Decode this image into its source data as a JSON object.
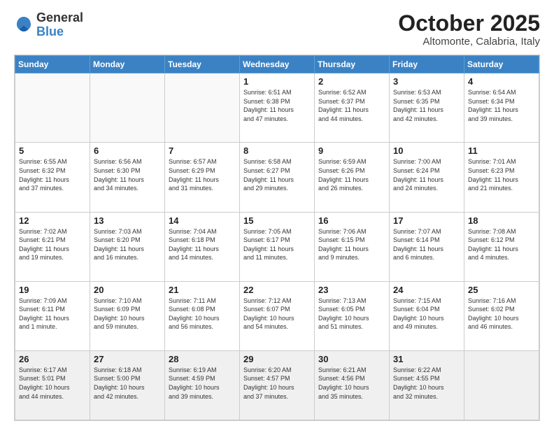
{
  "header": {
    "logo_general": "General",
    "logo_blue": "Blue",
    "month_title": "October 2025",
    "subtitle": "Altomonte, Calabria, Italy"
  },
  "days_of_week": [
    "Sunday",
    "Monday",
    "Tuesday",
    "Wednesday",
    "Thursday",
    "Friday",
    "Saturday"
  ],
  "weeks": [
    [
      {
        "day": "",
        "info": ""
      },
      {
        "day": "",
        "info": ""
      },
      {
        "day": "",
        "info": ""
      },
      {
        "day": "1",
        "info": "Sunrise: 6:51 AM\nSunset: 6:38 PM\nDaylight: 11 hours\nand 47 minutes."
      },
      {
        "day": "2",
        "info": "Sunrise: 6:52 AM\nSunset: 6:37 PM\nDaylight: 11 hours\nand 44 minutes."
      },
      {
        "day": "3",
        "info": "Sunrise: 6:53 AM\nSunset: 6:35 PM\nDaylight: 11 hours\nand 42 minutes."
      },
      {
        "day": "4",
        "info": "Sunrise: 6:54 AM\nSunset: 6:34 PM\nDaylight: 11 hours\nand 39 minutes."
      }
    ],
    [
      {
        "day": "5",
        "info": "Sunrise: 6:55 AM\nSunset: 6:32 PM\nDaylight: 11 hours\nand 37 minutes."
      },
      {
        "day": "6",
        "info": "Sunrise: 6:56 AM\nSunset: 6:30 PM\nDaylight: 11 hours\nand 34 minutes."
      },
      {
        "day": "7",
        "info": "Sunrise: 6:57 AM\nSunset: 6:29 PM\nDaylight: 11 hours\nand 31 minutes."
      },
      {
        "day": "8",
        "info": "Sunrise: 6:58 AM\nSunset: 6:27 PM\nDaylight: 11 hours\nand 29 minutes."
      },
      {
        "day": "9",
        "info": "Sunrise: 6:59 AM\nSunset: 6:26 PM\nDaylight: 11 hours\nand 26 minutes."
      },
      {
        "day": "10",
        "info": "Sunrise: 7:00 AM\nSunset: 6:24 PM\nDaylight: 11 hours\nand 24 minutes."
      },
      {
        "day": "11",
        "info": "Sunrise: 7:01 AM\nSunset: 6:23 PM\nDaylight: 11 hours\nand 21 minutes."
      }
    ],
    [
      {
        "day": "12",
        "info": "Sunrise: 7:02 AM\nSunset: 6:21 PM\nDaylight: 11 hours\nand 19 minutes."
      },
      {
        "day": "13",
        "info": "Sunrise: 7:03 AM\nSunset: 6:20 PM\nDaylight: 11 hours\nand 16 minutes."
      },
      {
        "day": "14",
        "info": "Sunrise: 7:04 AM\nSunset: 6:18 PM\nDaylight: 11 hours\nand 14 minutes."
      },
      {
        "day": "15",
        "info": "Sunrise: 7:05 AM\nSunset: 6:17 PM\nDaylight: 11 hours\nand 11 minutes."
      },
      {
        "day": "16",
        "info": "Sunrise: 7:06 AM\nSunset: 6:15 PM\nDaylight: 11 hours\nand 9 minutes."
      },
      {
        "day": "17",
        "info": "Sunrise: 7:07 AM\nSunset: 6:14 PM\nDaylight: 11 hours\nand 6 minutes."
      },
      {
        "day": "18",
        "info": "Sunrise: 7:08 AM\nSunset: 6:12 PM\nDaylight: 11 hours\nand 4 minutes."
      }
    ],
    [
      {
        "day": "19",
        "info": "Sunrise: 7:09 AM\nSunset: 6:11 PM\nDaylight: 11 hours\nand 1 minute."
      },
      {
        "day": "20",
        "info": "Sunrise: 7:10 AM\nSunset: 6:09 PM\nDaylight: 10 hours\nand 59 minutes."
      },
      {
        "day": "21",
        "info": "Sunrise: 7:11 AM\nSunset: 6:08 PM\nDaylight: 10 hours\nand 56 minutes."
      },
      {
        "day": "22",
        "info": "Sunrise: 7:12 AM\nSunset: 6:07 PM\nDaylight: 10 hours\nand 54 minutes."
      },
      {
        "day": "23",
        "info": "Sunrise: 7:13 AM\nSunset: 6:05 PM\nDaylight: 10 hours\nand 51 minutes."
      },
      {
        "day": "24",
        "info": "Sunrise: 7:15 AM\nSunset: 6:04 PM\nDaylight: 10 hours\nand 49 minutes."
      },
      {
        "day": "25",
        "info": "Sunrise: 7:16 AM\nSunset: 6:02 PM\nDaylight: 10 hours\nand 46 minutes."
      }
    ],
    [
      {
        "day": "26",
        "info": "Sunrise: 6:17 AM\nSunset: 5:01 PM\nDaylight: 10 hours\nand 44 minutes."
      },
      {
        "day": "27",
        "info": "Sunrise: 6:18 AM\nSunset: 5:00 PM\nDaylight: 10 hours\nand 42 minutes."
      },
      {
        "day": "28",
        "info": "Sunrise: 6:19 AM\nSunset: 4:59 PM\nDaylight: 10 hours\nand 39 minutes."
      },
      {
        "day": "29",
        "info": "Sunrise: 6:20 AM\nSunset: 4:57 PM\nDaylight: 10 hours\nand 37 minutes."
      },
      {
        "day": "30",
        "info": "Sunrise: 6:21 AM\nSunset: 4:56 PM\nDaylight: 10 hours\nand 35 minutes."
      },
      {
        "day": "31",
        "info": "Sunrise: 6:22 AM\nSunset: 4:55 PM\nDaylight: 10 hours\nand 32 minutes."
      },
      {
        "day": "",
        "info": ""
      }
    ]
  ]
}
